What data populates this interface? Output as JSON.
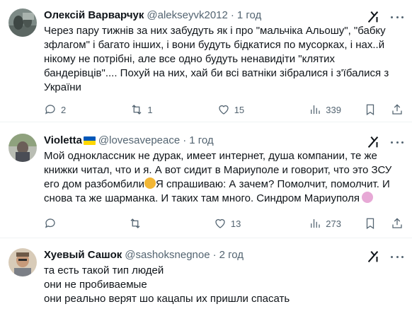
{
  "tweets": [
    {
      "name": "Олексій Варварчук",
      "handle": "@alekseyvk2012",
      "time": "1 год",
      "text": "Через пару тижнів за них забудуть як і про \"мальчіка Альошу\", \"бабку зфлагом\" і багато інших, і вони будуть бідкатися по мусорках, і нах..й нікому не потрібні, але все одно будуть ненавидіти \"клятих бандерівців\".... Похуй на них, хай би всі ватніки зібралися і з'їбалися з України",
      "replies": "2",
      "reposts": "1",
      "likes": "15",
      "views": "339"
    },
    {
      "name": "Violetta",
      "handle": "@lovesavepeace",
      "time": "1 год",
      "text_a": "Мой одноклассник не дурак, имеет интернет, душа компании, те же книжки читал, что и я. А вот сидит в Мариуполе и говорит, что это ЗСУ его дом разбомбили",
      "text_b": "Я спрашиваю: А зачем? Помолчит, помолчит. И снова та же шарманка. И таких там много. Синдром Мариуполя",
      "replies": "",
      "reposts": "",
      "likes": "13",
      "views": "273"
    },
    {
      "name": "Хуевый Сашок",
      "handle": "@sashoksnegnoe",
      "time": "2 год",
      "text": "та есть такой тип людей\nони не пробиваемые\nони реально верят шо кацапы их пришли спасать"
    }
  ],
  "separator": "·",
  "colors": {
    "text": "#0f1419",
    "secondary": "#536471",
    "border": "#eff3f4",
    "flag_blue": "#0057b7",
    "flag_yellow": "#ffd700"
  }
}
